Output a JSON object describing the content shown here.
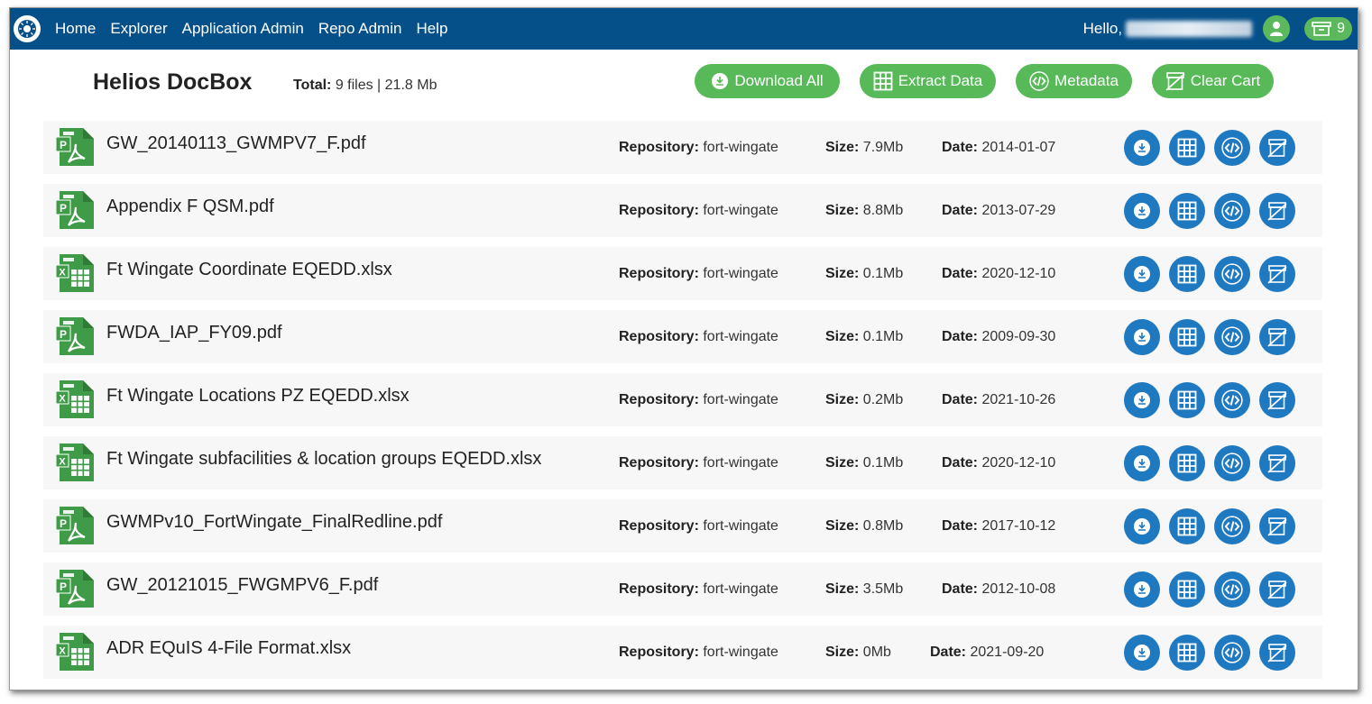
{
  "nav": {
    "links": [
      "Home",
      "Explorer",
      "Application Admin",
      "Repo Admin",
      "Help"
    ],
    "hello": "Hello,",
    "cart_count": "9"
  },
  "header": {
    "title": "Helios DocBox",
    "total_label": "Total:",
    "total_value": "9 files | 21.8 Mb",
    "buttons": {
      "download_all": "Download All",
      "extract_data": "Extract Data",
      "metadata": "Metadata",
      "clear_cart": "Clear Cart"
    }
  },
  "labels": {
    "repository": "Repository:",
    "size": "Size:",
    "date": "Date:"
  },
  "files": [
    {
      "name": "GW_20140113_GWMPV7_F.pdf",
      "type": "pdf",
      "repository": "fort-wingate",
      "size": "7.9Mb",
      "date": "2014-01-07"
    },
    {
      "name": "Appendix F QSM.pdf",
      "type": "pdf",
      "repository": "fort-wingate",
      "size": "8.8Mb",
      "date": "2013-07-29"
    },
    {
      "name": "Ft Wingate Coordinate EQEDD.xlsx",
      "type": "xlsx",
      "repository": "fort-wingate",
      "size": "0.1Mb",
      "date": "2020-12-10"
    },
    {
      "name": "FWDA_IAP_FY09.pdf",
      "type": "pdf",
      "repository": "fort-wingate",
      "size": "0.1Mb",
      "date": "2009-09-30"
    },
    {
      "name": "Ft Wingate Locations PZ EQEDD.xlsx",
      "type": "xlsx",
      "repository": "fort-wingate",
      "size": "0.2Mb",
      "date": "2021-10-26"
    },
    {
      "name": "Ft Wingate subfacilities & location groups EQEDD.xlsx",
      "type": "xlsx",
      "repository": "fort-wingate",
      "size": "0.1Mb",
      "date": "2020-12-10"
    },
    {
      "name": "GWMPv10_FortWingate_FinalRedline.pdf",
      "type": "pdf",
      "repository": "fort-wingate",
      "size": "0.8Mb",
      "date": "2017-10-12"
    },
    {
      "name": "GW_20121015_FWGMPV6_F.pdf",
      "type": "pdf",
      "repository": "fort-wingate",
      "size": "3.5Mb",
      "date": "2012-10-08"
    },
    {
      "name": "ADR EQuIS 4-File Format.xlsx",
      "type": "xlsx",
      "repository": "fort-wingate",
      "size": "0Mb",
      "date": "2021-09-20"
    }
  ],
  "colors": {
    "navbar": "#065089",
    "green_button": "#57b957",
    "blue_circle": "#1f79c1",
    "row_bg": "#f7f7f7",
    "file_icon_green": "#3f9b48"
  },
  "icons": {
    "download": "download-icon",
    "extract": "table-grid-icon",
    "metadata": "code-icon",
    "clear": "clear-cart-icon",
    "user": "user-icon",
    "cart": "cart-box-icon"
  }
}
